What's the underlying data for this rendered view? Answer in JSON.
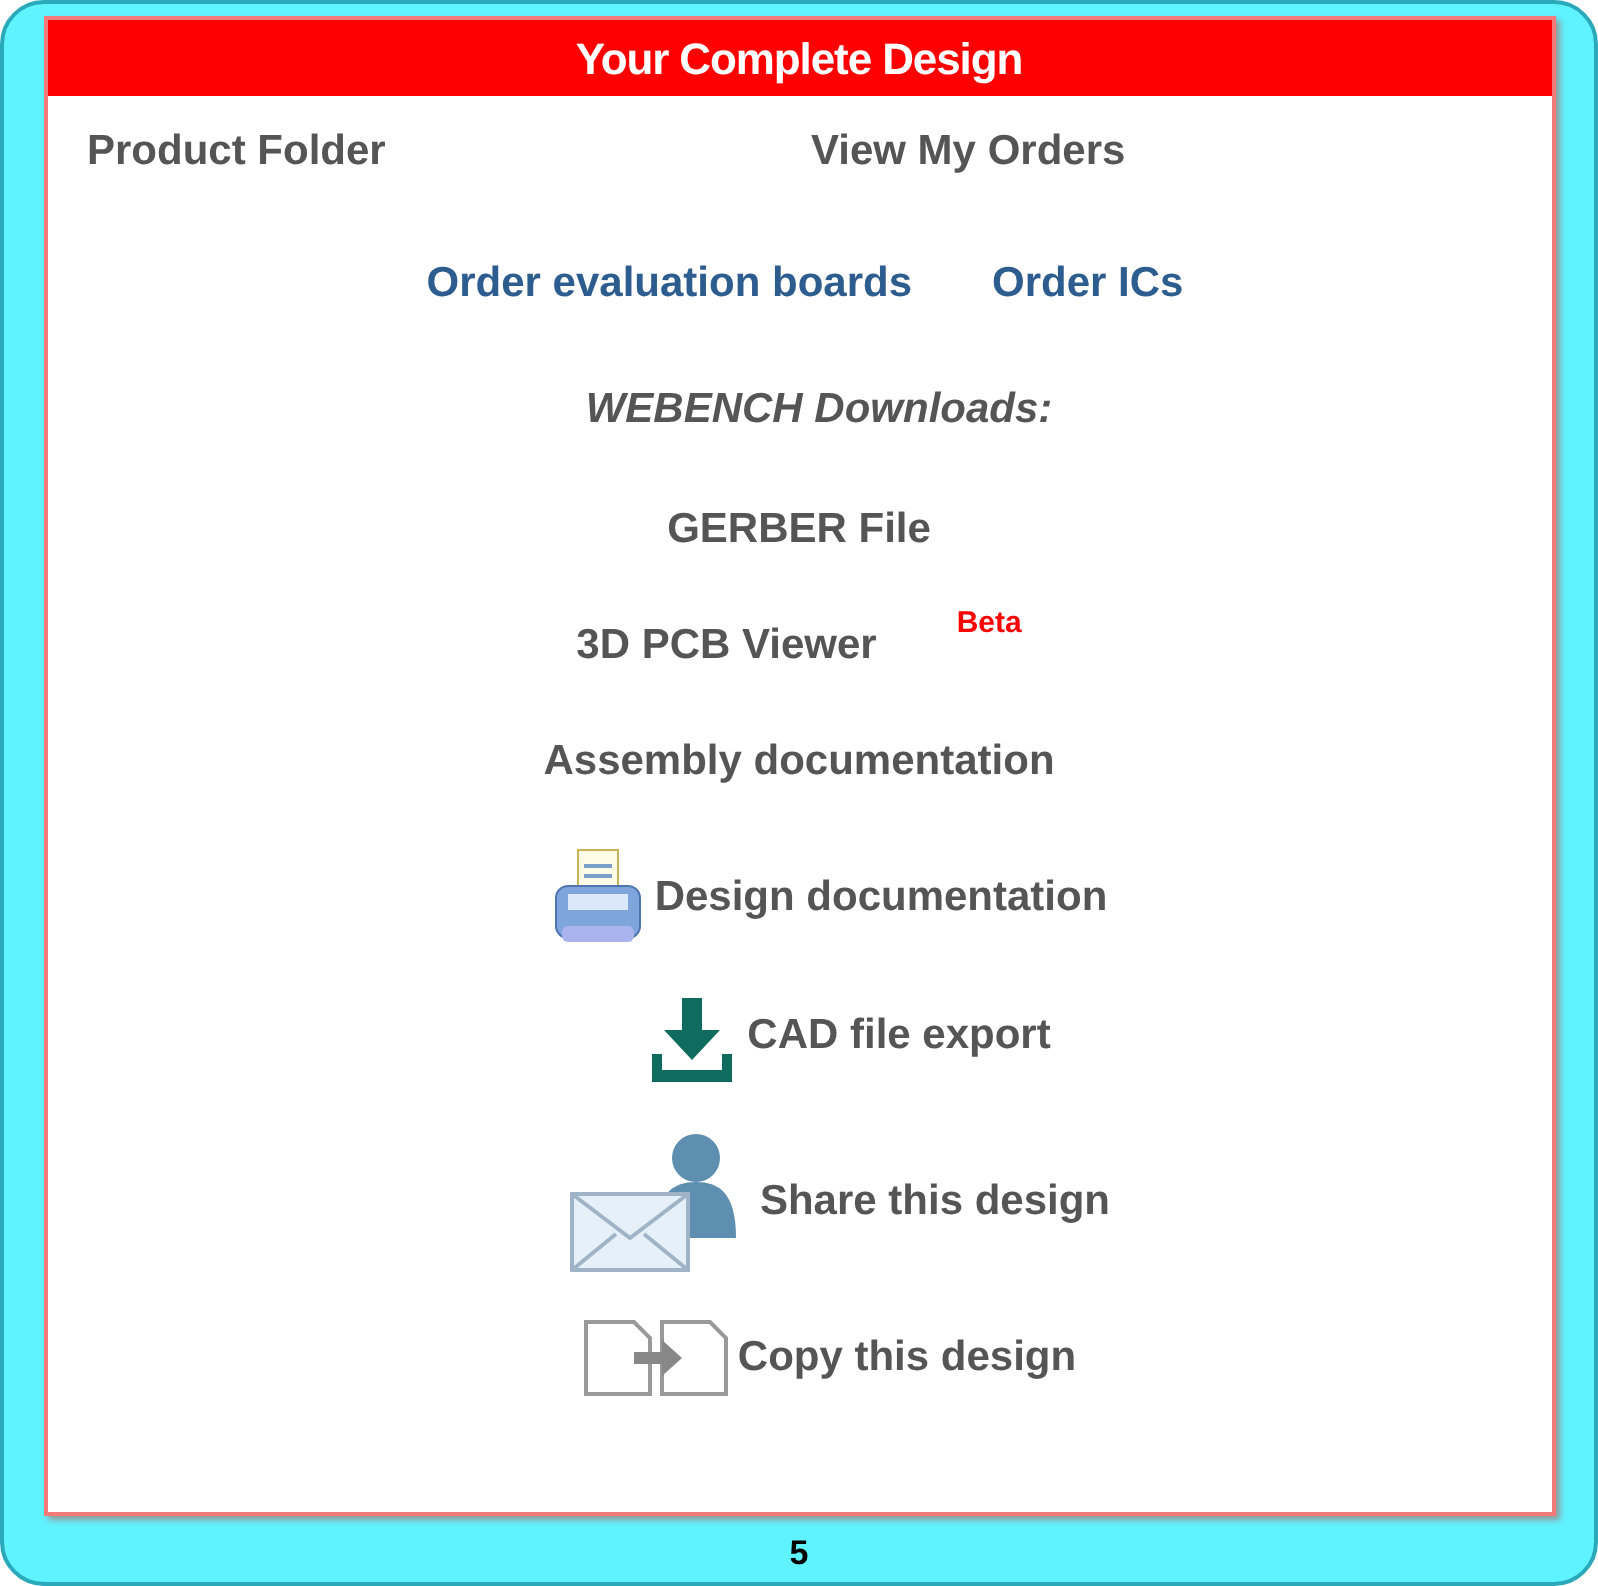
{
  "panel": {
    "title": "Your Complete Design",
    "top_links": [
      "Product Folder",
      "View My Orders"
    ],
    "order_links": [
      "Order evaluation boards",
      "Order ICs"
    ],
    "downloads_heading": "WEBENCH Downloads:",
    "items": [
      {
        "kind": "text",
        "label": "GERBER File"
      },
      {
        "kind": "text",
        "label": "3D PCB Viewer",
        "badge": "Beta"
      },
      {
        "kind": "text",
        "label": "Assembly documentation"
      },
      {
        "kind": "printer",
        "label": "Design documentation"
      },
      {
        "kind": "download",
        "label": "CAD file export"
      },
      {
        "kind": "share",
        "label": "Share this design"
      },
      {
        "kind": "copy",
        "label": "Copy this design"
      }
    ]
  },
  "page_number": "5"
}
